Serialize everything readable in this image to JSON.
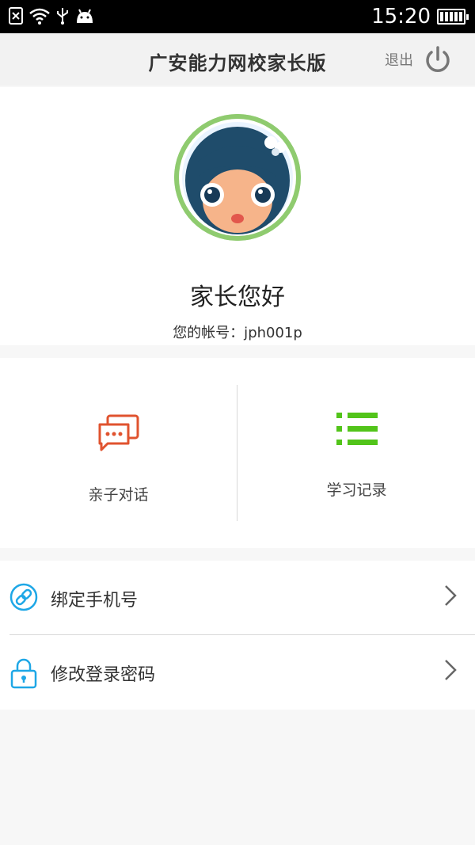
{
  "status_bar": {
    "time": "15:20"
  },
  "header": {
    "title": "广安能力网校家长版",
    "logout_label": "退出"
  },
  "profile": {
    "greeting": "家长您好",
    "account_label": "您的帐号：jph001p"
  },
  "actions": [
    {
      "label": "亲子对话",
      "icon": "chat-bubbles-icon",
      "color": "#e0532f"
    },
    {
      "label": "学习记录",
      "icon": "list-icon",
      "color": "#52c41a"
    }
  ],
  "settings": [
    {
      "label": "绑定手机号",
      "icon": "link-icon"
    },
    {
      "label": "修改登录密码",
      "icon": "lock-icon"
    }
  ],
  "colors": {
    "accent_blue": "#1ea7e6",
    "avatar_ring": "#8fcb6f"
  }
}
